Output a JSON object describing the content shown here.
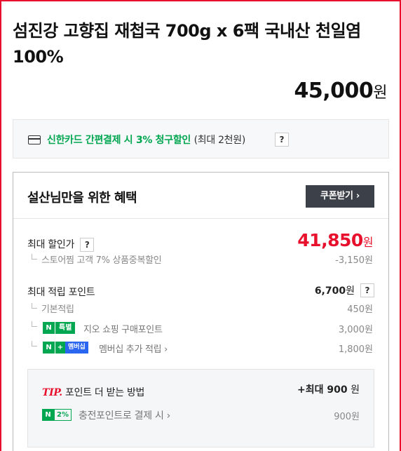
{
  "product": {
    "title": "섬진강 고향집 재첩국 700g x 6팩 국내산 천일염 100%",
    "price": "45,000",
    "price_unit": "원"
  },
  "card_promo": {
    "icon": "credit-card-icon",
    "text": "신한카드 간편결제 시 3% 청구할인",
    "sub": "(최대 2천원)",
    "help": "?"
  },
  "benefit": {
    "title": "설산님만을 위한 혜택",
    "coupon_button": "쿠폰받기 ›",
    "max_discount": {
      "label": "최대 할인가",
      "help": "?",
      "value": "41,850",
      "unit": "원",
      "detail_label": "스토어찜 고객 7% 상품중복할인",
      "detail_value": "-3,150원"
    },
    "max_points": {
      "label": "최대 적립 포인트",
      "value": "6,700",
      "unit": "원",
      "help": "?",
      "items": [
        {
          "label": "기본적립",
          "value": "450원"
        },
        {
          "badge_n": "N",
          "badge": "특별",
          "label": "지오 쇼핑 구매포인트",
          "value": "3,000원"
        },
        {
          "badge_n": "N",
          "badge_plus": "+",
          "badge": "멤버십",
          "label": "멤버십 추가 적립 ›",
          "value": "1,800원"
        }
      ]
    },
    "tip": {
      "tag": "TIP.",
      "title": "포인트 더 받는 방법",
      "max_prefix": "+최대 ",
      "max_value": "900",
      "max_unit": " 원",
      "item": {
        "badge_n": "N",
        "badge": "2%",
        "label": "충전포인트로 결제 시 ›",
        "value": "900원"
      }
    }
  },
  "colors": {
    "accent_red": "#e8112d",
    "naver_green": "#00a650",
    "membership_blue": "#2a66f0"
  }
}
